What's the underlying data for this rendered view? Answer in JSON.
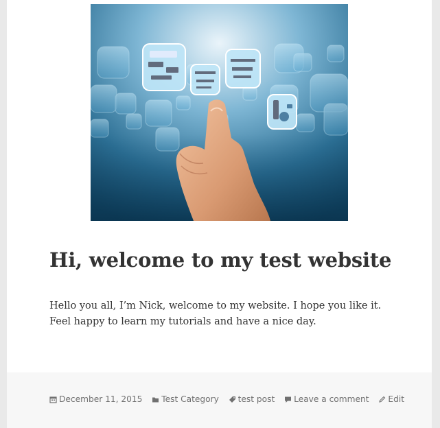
{
  "post": {
    "title": "Hi, welcome to my test website",
    "body": "Hello you all, I’m Nick, welcome to my website. I hope you like it. Feel happy to learn my tutorials and have a nice day.",
    "featured_image": "hand-touching-digital-tiles-photo"
  },
  "footer": {
    "date": "December 11, 2015",
    "category": "Test Category",
    "tag": "test post",
    "comment": "Leave a comment",
    "edit": "Edit"
  },
  "icons": {
    "date": "calendar-icon",
    "category": "folder-icon",
    "tag": "tag-icon",
    "comment": "comment-bubble-icon",
    "edit": "pencil-icon"
  },
  "colors": {
    "text": "#333333",
    "meta": "#707070",
    "footer_bg": "#f7f7f7",
    "page_bg": "#e9e9e9"
  }
}
